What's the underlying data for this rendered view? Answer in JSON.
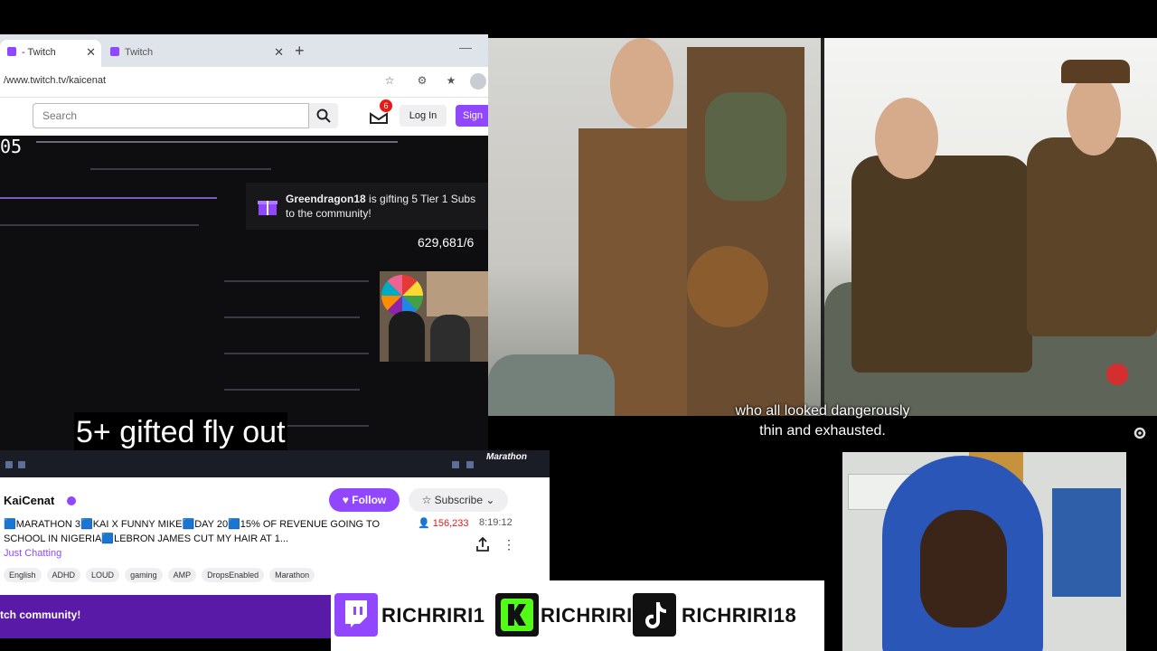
{
  "browser": {
    "tabs": [
      {
        "label": "- Twitch",
        "active": true
      },
      {
        "label": "Twitch",
        "active": false
      }
    ],
    "url": "/www.twitch.tv/kaicenat",
    "search": {
      "placeholder": "Search"
    },
    "notification_count": "6",
    "login_label": "Log In",
    "signup_label": "Sign"
  },
  "stream": {
    "timer": "05",
    "gift": {
      "user": "Greendragon18",
      "line1_rest": " is gifting 5 Tier 1 Subs",
      "line2": "to the community!"
    },
    "viewer_total": "629,681/6"
  },
  "caption_overlay": "5+ gifted fly out",
  "taskbar_logo": "Marathon",
  "channel": {
    "name": "KaiCenat",
    "follow_label": "Follow",
    "subscribe_label": "Subscribe",
    "title": "🟦MARATHON 3🟦KAI X FUNNY MIKE🟦DAY 20🟦15% OF REVENUE GOING TO SCHOOL IN NIGERIA🟦LEBRON JAMES CUT MY HAIR AT 1...",
    "viewers": "156,233",
    "uptime": "8:19:12",
    "category": "Just Chatting",
    "tags": [
      "English",
      "ADHD",
      "LOUD",
      "gaming",
      "AMP",
      "DropsEnabled",
      "Marathon"
    ]
  },
  "community_banner": "tch community!",
  "video": {
    "subtitle_line1": "who all looked dangerously",
    "subtitle_line2": "thin and exhausted."
  },
  "socials": [
    {
      "platform_icon": "twitch-logo-icon",
      "handle": "RICHRIRI1",
      "color": "#9146ff"
    },
    {
      "platform_icon": "kick-logo-icon",
      "handle": "RICHRIRI",
      "color": "#53fc18"
    },
    {
      "platform_icon": "tiktok-logo-icon",
      "handle": "RICHRIRI18",
      "color": "#111111"
    }
  ],
  "colors": {
    "twitch_purple": "#9146ff",
    "banner_purple": "#5a1aa8",
    "live_red": "#e91916"
  }
}
